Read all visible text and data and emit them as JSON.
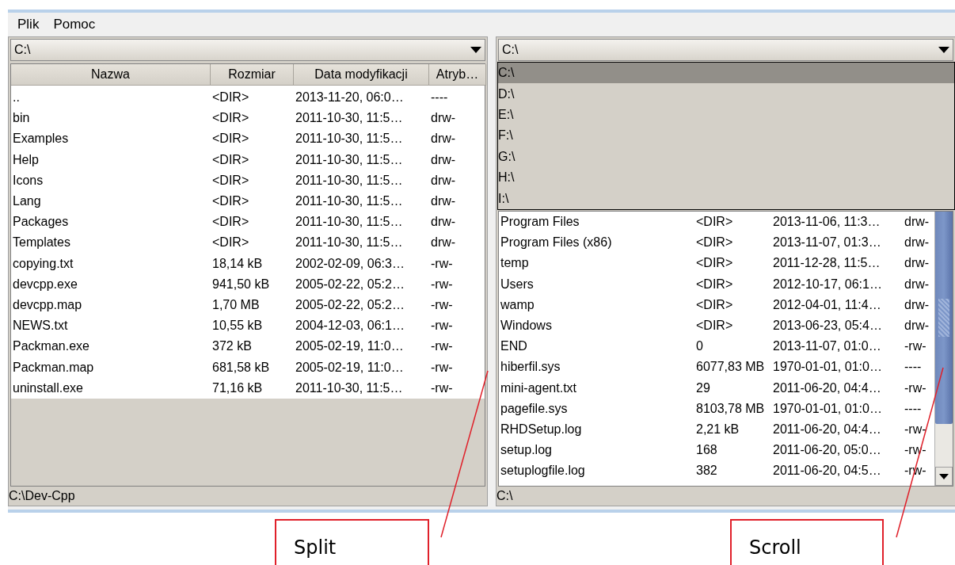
{
  "menu": [
    "Plik",
    "Pomoc"
  ],
  "left_panel": {
    "drive": "C:\\",
    "columns": [
      "Nazwa",
      "Rozmiar",
      "Data modyfikacji",
      "Atryb…"
    ],
    "rows": [
      [
        "..",
        "<DIR>",
        "2013-11-20, 06:0…",
        "----"
      ],
      [
        "bin",
        "<DIR>",
        "2011-10-30, 11:5…",
        "drw-"
      ],
      [
        "Examples",
        "<DIR>",
        "2011-10-30, 11:5…",
        "drw-"
      ],
      [
        "Help",
        "<DIR>",
        "2011-10-30, 11:5…",
        "drw-"
      ],
      [
        "Icons",
        "<DIR>",
        "2011-10-30, 11:5…",
        "drw-"
      ],
      [
        "Lang",
        "<DIR>",
        "2011-10-30, 11:5…",
        "drw-"
      ],
      [
        "Packages",
        "<DIR>",
        "2011-10-30, 11:5…",
        "drw-"
      ],
      [
        "Templates",
        "<DIR>",
        "2011-10-30, 11:5…",
        "drw-"
      ],
      [
        "copying.txt",
        "18,14 kB",
        "2002-02-09, 06:3…",
        "-rw-"
      ],
      [
        "devcpp.exe",
        "941,50 kB",
        "2005-02-22, 05:2…",
        "-rw-"
      ],
      [
        "devcpp.map",
        "1,70 MB",
        "2005-02-22, 05:2…",
        "-rw-"
      ],
      [
        "NEWS.txt",
        "10,55 kB",
        "2004-12-03, 06:1…",
        "-rw-"
      ],
      [
        "Packman.exe",
        "372 kB",
        "2005-02-19, 11:0…",
        "-rw-"
      ],
      [
        "Packman.map",
        "681,58 kB",
        "2005-02-19, 11:0…",
        "-rw-"
      ],
      [
        "uninstall.exe",
        "71,16 kB",
        "2011-10-30, 11:5…",
        "-rw-"
      ]
    ],
    "status": "C:\\Dev-Cpp"
  },
  "right_panel": {
    "drive": "C:\\",
    "drive_list": [
      {
        "label": "C:\\",
        "selected": true
      },
      {
        "label": "D:\\",
        "selected": false
      },
      {
        "label": "E:\\",
        "selected": false
      },
      {
        "label": "F:\\",
        "selected": false
      },
      {
        "label": "G:\\",
        "selected": false
      },
      {
        "label": "H:\\",
        "selected": false
      },
      {
        "label": "I:\\",
        "selected": false
      }
    ],
    "rows": [
      [
        "Program Files",
        "<DIR>",
        "2013-11-06, 11:3…",
        "drw-"
      ],
      [
        "Program Files (x86)",
        "<DIR>",
        "2013-11-07, 01:3…",
        "drw-"
      ],
      [
        "temp",
        "<DIR>",
        "2011-12-28, 11:5…",
        "drw-"
      ],
      [
        "Users",
        "<DIR>",
        "2012-10-17, 06:1…",
        "drw-"
      ],
      [
        "wamp",
        "<DIR>",
        "2012-04-01, 11:4…",
        "drw-"
      ],
      [
        "Windows",
        "<DIR>",
        "2013-06-23, 05:4…",
        "drw-"
      ],
      [
        "END",
        "0",
        "2013-11-07, 01:0…",
        "-rw-"
      ],
      [
        "hiberfil.sys",
        "6077,83 MB",
        "1970-01-01, 01:0…",
        "----"
      ],
      [
        "mini-agent.txt",
        "29",
        "2011-06-20, 04:4…",
        "-rw-"
      ],
      [
        "pagefile.sys",
        "8103,78 MB",
        "1970-01-01, 01:0…",
        "----"
      ],
      [
        "RHDSetup.log",
        "2,21 kB",
        "2011-06-20, 04:4…",
        "-rw-"
      ],
      [
        "setup.log",
        "168",
        "2011-06-20, 05:0…",
        "-rw-"
      ],
      [
        "setuplogfile.log",
        "382",
        "2011-06-20, 04:5…",
        "-rw-"
      ]
    ],
    "status": "C:\\"
  },
  "annotations": [
    {
      "label": "Split"
    },
    {
      "label": "Scroll"
    }
  ]
}
